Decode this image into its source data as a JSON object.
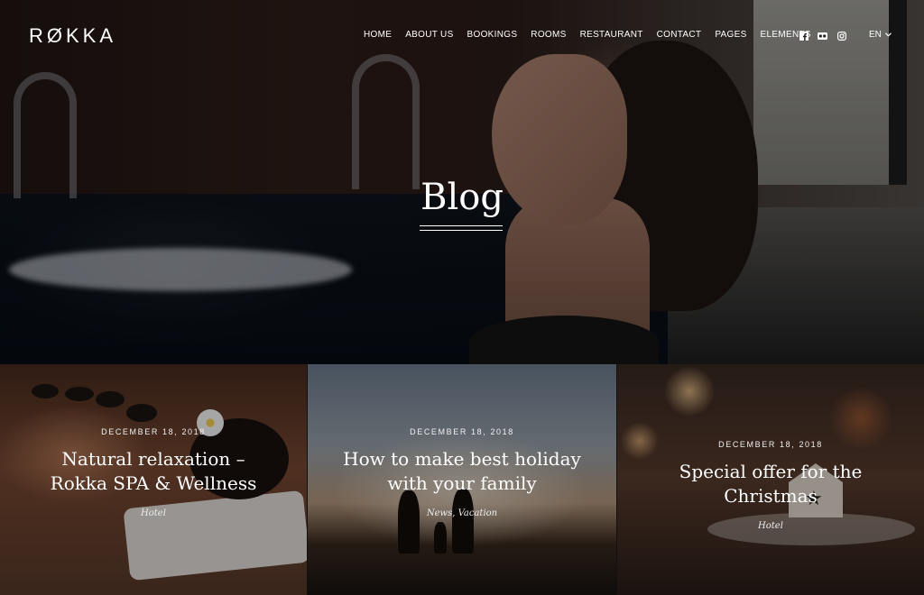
{
  "brand": {
    "logo": "RØKKA"
  },
  "nav": {
    "items": [
      {
        "label": "HOME"
      },
      {
        "label": "ABOUT US"
      },
      {
        "label": "BOOKINGS"
      },
      {
        "label": "ROOMS"
      },
      {
        "label": "RESTAURANT"
      },
      {
        "label": "CONTACT"
      },
      {
        "label": "PAGES"
      },
      {
        "label": "ELEMENTS"
      }
    ],
    "social_icons": [
      "facebook-icon",
      "tripadvisor-icon",
      "instagram-icon"
    ],
    "language": "EN"
  },
  "hero": {
    "title": "Blog"
  },
  "posts": [
    {
      "date": "DECEMBER 18, 2018",
      "title": "Natural relaxation – Rokka SPA & Wellness",
      "category": "Hotel"
    },
    {
      "date": "DECEMBER 18, 2018",
      "title": "How to make best holiday with your family",
      "category": "News, Vacation"
    },
    {
      "date": "DECEMBER 18, 2018",
      "title": "Special offer for the Christmas",
      "category": "Hotel"
    }
  ],
  "colors": {
    "text": "#ffffff",
    "overlay": "rgba(0,0,0,0.35)"
  }
}
